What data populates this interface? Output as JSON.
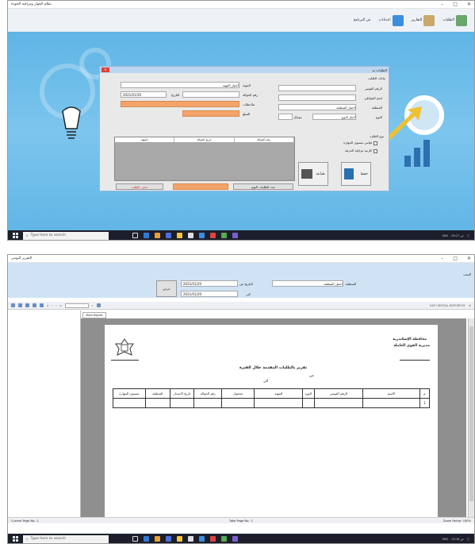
{
  "shot1": {
    "window_title": "نظام الجهاز ومراقبة الجودة",
    "toolbar": [
      {
        "label": "الطلبات",
        "icon": "clipboard-icon"
      },
      {
        "label": "التقارير",
        "icon": "report-icon"
      },
      {
        "label": "اعدادات",
        "icon": "settings-icon"
      },
      {
        "label": "عن البرنامج",
        "icon": "info-icon"
      }
    ],
    "dialog": {
      "title": "الطلبات ية",
      "section_title": "بيانات الطلب",
      "labels": {
        "national_id": "الرقم القومي",
        "citizen_name": "اسم المواطن",
        "region": "المنطقة",
        "type": "النوع",
        "profession": "المهنة",
        "transfer_no": "رقم الحوالة",
        "date": "التاريخ",
        "notes": "ملاحظات",
        "amount": "المبلغ",
        "form_no": "موبايل"
      },
      "values": {
        "profession_select": "اختيار المهنة",
        "date": "2021/01/20",
        "region_select": "اختيار المنطقة",
        "type_select": "اختار النوع"
      },
      "grid_headers": [
        "رقم الحوالة",
        "تاريخ الحوالة",
        "المهنة"
      ],
      "request_type": {
        "title": "نوع الطلب",
        "opt1": "قياس مستوى الجهارة",
        "opt2": "كارنية مزاولة الحرفة"
      },
      "buttons": {
        "save": "حفظ",
        "print": "طباعه",
        "delete": "حذف الطلب",
        "today": "عدد الطلبات اليوم"
      }
    }
  },
  "shot2": {
    "window_title": "التقرير اليومي",
    "filter": {
      "search_label": "البحث",
      "region_label": "المنطقة",
      "region_select": "اختيار المنطقة",
      "from_label": "التاريخ من",
      "to_label": "الى",
      "date_from": "2021/01/20",
      "date_to": "2021/01/20",
      "show_button": "عرض"
    },
    "viewer": {
      "brand": "SAP CRYSTAL REPORTS®",
      "page_tab": "Main Report",
      "status_current": "Current Page No.: 1",
      "status_total": "Total Page No.: 1",
      "status_zoom": "Zoom Factor: 100%"
    },
    "report": {
      "org_line1": "محافظة الإسكندرية",
      "org_line2": "مديرية القوى العاملة",
      "title": "تقرير بالطلبات المقدمة خلال الفترة",
      "from_word": "من",
      "to_word": "الى",
      "columns": [
        "م",
        "الاسم",
        "الرقم القومي",
        "النوع",
        "المهنة",
        "محمول",
        "رقم الحوالة",
        "تاريخ الاصدار",
        "المنطقة",
        "مستوى المهارة"
      ],
      "row_number": "1"
    }
  },
  "taskbar": {
    "search_placeholder": "Type here to search",
    "lang": "ENG",
    "time1": "09:27 ص",
    "time2": "10:18 ص"
  }
}
